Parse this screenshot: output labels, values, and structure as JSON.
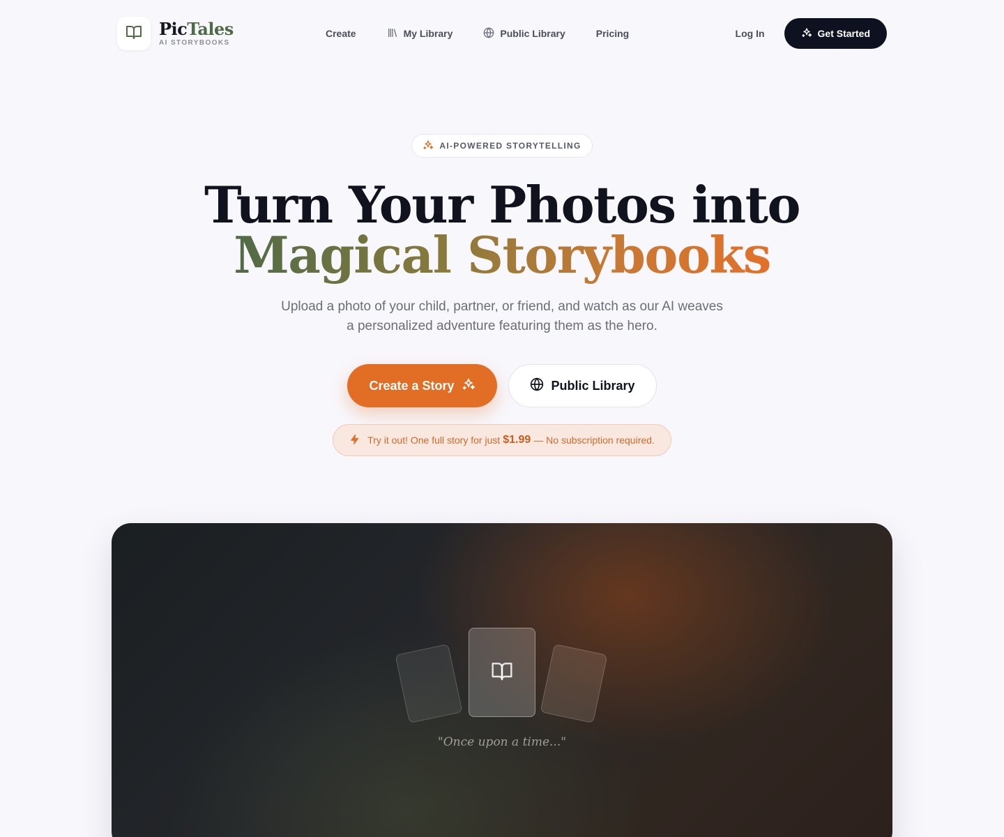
{
  "brand": {
    "name_part1": "Pic",
    "name_part2": "Tales",
    "subtitle": "AI STORYBOOKS",
    "logo_icon": "open-book-icon"
  },
  "nav": {
    "links": [
      {
        "label": "Create",
        "icon": null
      },
      {
        "label": "My Library",
        "icon": "library-icon"
      },
      {
        "label": "Public Library",
        "icon": "globe-icon"
      },
      {
        "label": "Pricing",
        "icon": null
      }
    ],
    "login_label": "Log In",
    "cta_label": "Get Started",
    "cta_icon": "sparkles-icon"
  },
  "hero": {
    "badge": "AI-POWERED STORYTELLING",
    "headline_line1": "Turn Your Photos into",
    "headline_line2": "Magical Storybooks",
    "subtitle": "Upload a photo of your child, partner, or friend, and watch as our AI weaves a personalized adventure featuring them as the hero.",
    "primary_cta": "Create a Story",
    "secondary_cta": "Public Library",
    "promo": {
      "prefix": "Try it out! One full story for just",
      "price": "$1.99",
      "suffix": "— No subscription required.",
      "icon": "lightning-icon"
    }
  },
  "preview": {
    "quote": "\"Once upon a time...\"",
    "center_icon": "open-book-icon"
  },
  "colors": {
    "background": "#f8f7fc",
    "primary_orange": "#e26d25",
    "dark": "#0e1220",
    "brand_green": "#4f6b46",
    "promo_bg": "#f8e8df"
  }
}
